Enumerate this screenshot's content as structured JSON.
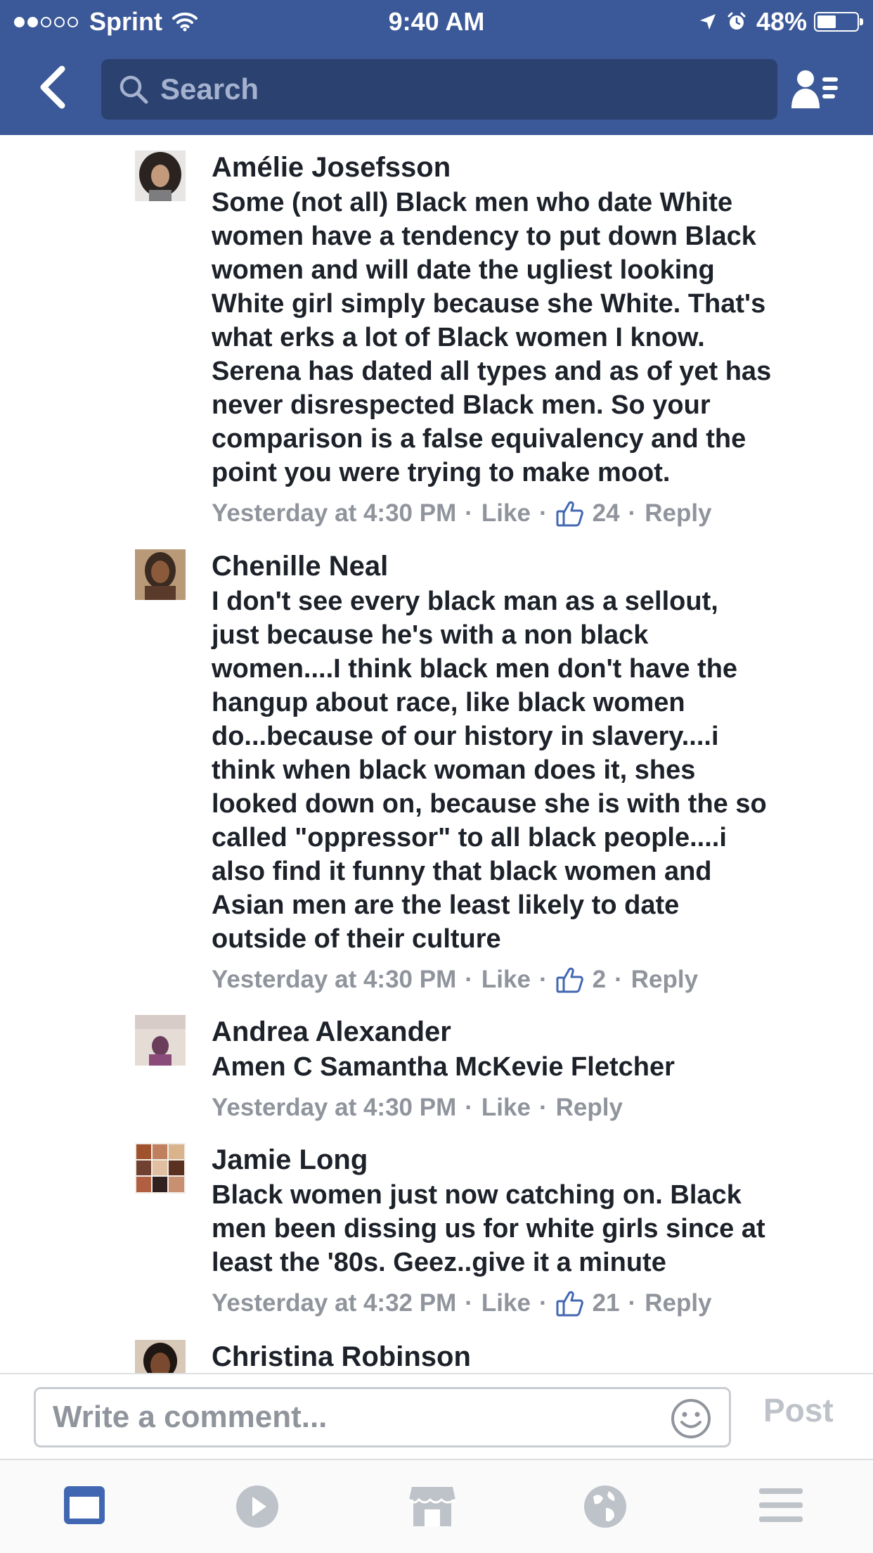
{
  "status_bar": {
    "signal_dots_filled": 2,
    "signal_dots_total": 5,
    "carrier": "Sprint",
    "time": "9:40 AM",
    "battery": "48%",
    "battery_level": 0.48
  },
  "nav": {
    "search_placeholder": "Search"
  },
  "comments": [
    {
      "author": "Amélie Josefsson",
      "text": "Some (not all) Black men who date White\nwomen have a tendency to put down Black\nwomen and will date the ugliest looking\nWhite girl simply because she White. That's\nwhat erks a lot of Black women I know.\nSerena has dated all types and as of yet has\nnever disrespected Black men. So your\ncomparison is a false equivalency and the\npoint you were trying to make moot.",
      "time": "Yesterday at 4:30 PM",
      "like_label": "Like",
      "likes": "24",
      "reply_label": "Reply"
    },
    {
      "author": "Chenille Neal",
      "text": "I don't  see every black man as a  sellout,\njust because he's with a non black\nwomen....I think black men don't have the\nhangup about race, like black women\ndo...because of our history in slavery....i\nthink  when black woman does it, shes\nlooked down on, because  she is with the so\ncalled \"oppressor\" to all black people....i\nalso find it funny that black women and\nAsian men are the least likely to date\noutside of their culture",
      "time": "Yesterday at 4:30 PM",
      "like_label": "Like",
      "likes": "2",
      "reply_label": "Reply"
    },
    {
      "author": "Andrea Alexander",
      "text": "Amen C Samantha McKevie Fletcher",
      "time": "Yesterday at 4:30 PM",
      "like_label": "Like",
      "reply_label": "Reply"
    },
    {
      "author": "Jamie Long",
      "text": "Black women just now catching on. Black\nmen been dissing us for white girls since at\nleast the '80s.  Geez..give it a minute",
      "time": "Yesterday at 4:32 PM",
      "like_label": "Like",
      "likes": "21",
      "reply_label": "Reply"
    },
    {
      "author": "Christina Robinson",
      "text": ""
    }
  ],
  "composer": {
    "placeholder": "Write a comment...",
    "post_label": "Post"
  },
  "tabs": [
    {
      "icon": "news-feed-icon",
      "active": true
    },
    {
      "icon": "video-play-icon",
      "active": false
    },
    {
      "icon": "marketplace-icon",
      "active": false
    },
    {
      "icon": "globe-notifications-icon",
      "active": false
    },
    {
      "icon": "menu-icon",
      "active": false
    }
  ],
  "colors": {
    "brand_blue": "#3b5998",
    "search_bg": "#2b4170",
    "meta_gray": "#90949c",
    "like_blue": "#4267b2",
    "active_tab": "#4267b2",
    "inactive_tab": "#bec3c9"
  }
}
